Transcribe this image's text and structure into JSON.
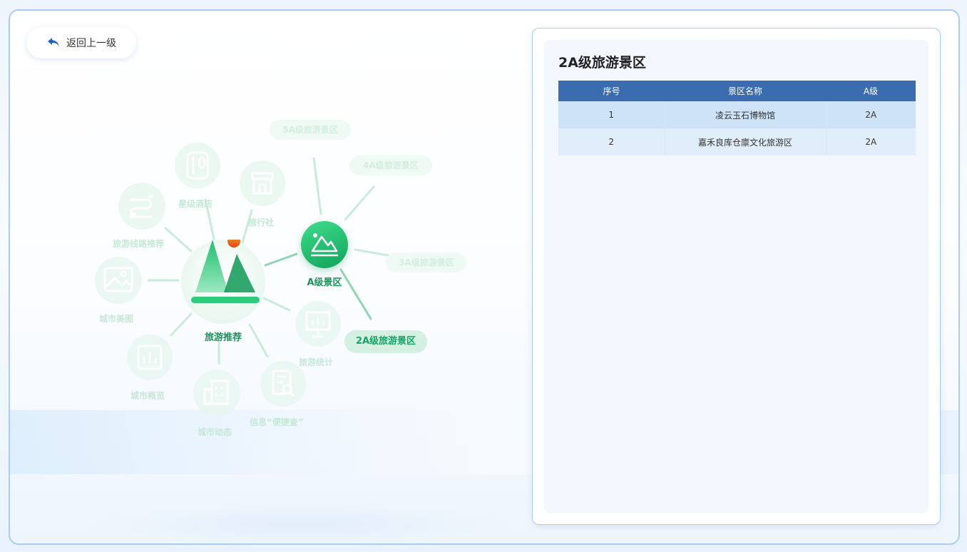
{
  "back_button": {
    "label": "返回上一级",
    "icon": "back-arrow-icon"
  },
  "mindmap": {
    "center": {
      "label": "旅游推荐",
      "icon": "mountain-icon"
    },
    "active_node": {
      "label": "A级景区",
      "icon": "landscape-icon"
    },
    "selected_child": "2A级旅游景区",
    "faded_children": [
      "5A级旅游景区",
      "4A级旅游景区",
      "3A级旅游景区"
    ],
    "faded_nodes": [
      {
        "label": "星级酒店",
        "icon": "dining-icon"
      },
      {
        "label": "旅行社",
        "icon": "storefront-icon"
      },
      {
        "label": "旅游线路推荐",
        "icon": "route-icon"
      },
      {
        "label": "城市美图",
        "icon": "photo-icon"
      },
      {
        "label": "城市概览",
        "icon": "chart-icon"
      },
      {
        "label": "城市动态",
        "icon": "building-icon"
      },
      {
        "label": "信息“便捷查”",
        "icon": "search-doc-icon"
      },
      {
        "label": "旅游统计",
        "icon": "presentation-icon"
      }
    ]
  },
  "panel": {
    "title": "2A级旅游景区",
    "columns": [
      "序号",
      "景区名称",
      "A级"
    ],
    "rows": [
      [
        "1",
        "凌云玉石博物馆",
        "2A"
      ],
      [
        "2",
        "嘉禾良库仓廪文化旅游区",
        "2A"
      ]
    ]
  },
  "colors": {
    "green": "#16a365",
    "table_header": "#3a6caf",
    "border": "#a9cdf3"
  }
}
